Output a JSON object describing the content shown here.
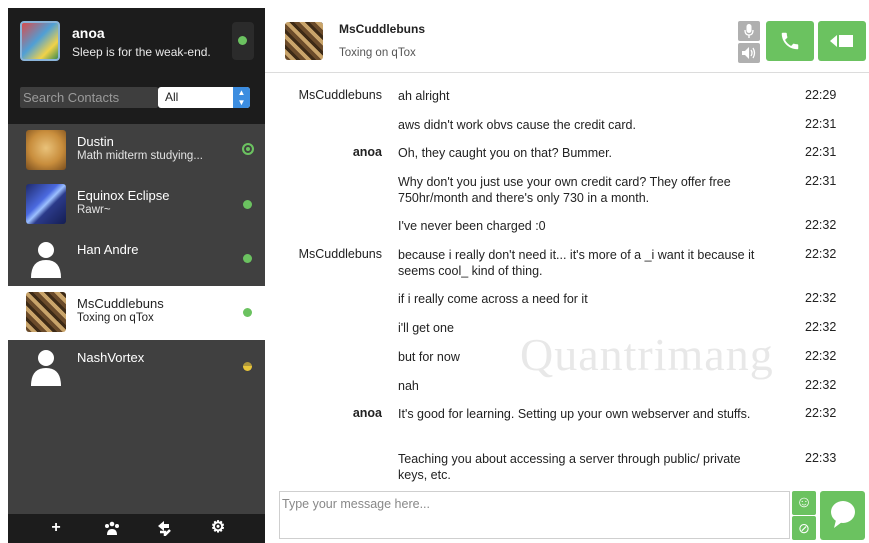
{
  "self": {
    "name": "anoa",
    "status_message": "Sleep is for the weak-end."
  },
  "search": {
    "placeholder": "Search Contacts",
    "filter_value": "All"
  },
  "contacts": [
    {
      "name": "Dustin",
      "status": "Math midterm studying...",
      "presence": "online"
    },
    {
      "name": "Equinox Eclipse",
      "status": "Rawr~",
      "presence": "online"
    },
    {
      "name": "Han Andre",
      "status": "",
      "presence": "online"
    },
    {
      "name": "MsCuddlebuns",
      "status": "Toxing on qTox",
      "presence": "online",
      "active": true
    },
    {
      "name": "NashVortex",
      "status": "",
      "presence": "away"
    }
  ],
  "chat": {
    "contact_name": "MsCuddlebuns",
    "contact_status": "Toxing on qTox",
    "input_placeholder": "Type your message here..."
  },
  "messages": [
    {
      "author": "MsCuddlebuns",
      "text": "ah alright",
      "time": "22:29"
    },
    {
      "author": "",
      "text": "aws didn't work obvs cause the credit card.",
      "time": "22:31"
    },
    {
      "author": "anoa",
      "text": "Oh, they caught you on that? Bummer.",
      "time": "22:31"
    },
    {
      "author": "",
      "text": "Why don't you just use your own credit card? They offer free 750hr/month and there's only 730 in a month.",
      "time": "22:31"
    },
    {
      "author": "",
      "text": "I've never been charged :0",
      "time": "22:32"
    },
    {
      "author": "MsCuddlebuns",
      "text": "because i really don't need it... it's more of a _i want it because it seems cool_ kind of thing.",
      "time": "22:32"
    },
    {
      "author": "",
      "text": "if i really come across a need for it",
      "time": "22:32"
    },
    {
      "author": "",
      "text": "i'll get one",
      "time": "22:32"
    },
    {
      "author": "",
      "text": "but for now",
      "time": "22:32"
    },
    {
      "author": "",
      "text": "nah",
      "time": "22:32"
    },
    {
      "author": "anoa",
      "text": "It's good for learning. Setting up your own webserver and stuffs.",
      "time": "22:32"
    },
    {
      "author": "",
      "text": "Teaching you about accessing a server through public/ private keys, etc.",
      "time": "22:33"
    }
  ],
  "watermark": "Quantrimang",
  "colors": {
    "accent_green": "#6bc260",
    "away_yellow": "#e8c53a",
    "sidebar_bg": "#404040",
    "sidebar_dark": "#1c1c1c",
    "select_blue": "#3c8de0"
  },
  "icons": {
    "toolbar": [
      "add-icon",
      "group-icon",
      "transfer-icon",
      "settings-icon"
    ],
    "header": [
      "microphone-icon",
      "speaker-icon",
      "phone-icon",
      "video-icon"
    ],
    "input": [
      "emoji-icon",
      "attach-icon",
      "send-icon"
    ]
  }
}
